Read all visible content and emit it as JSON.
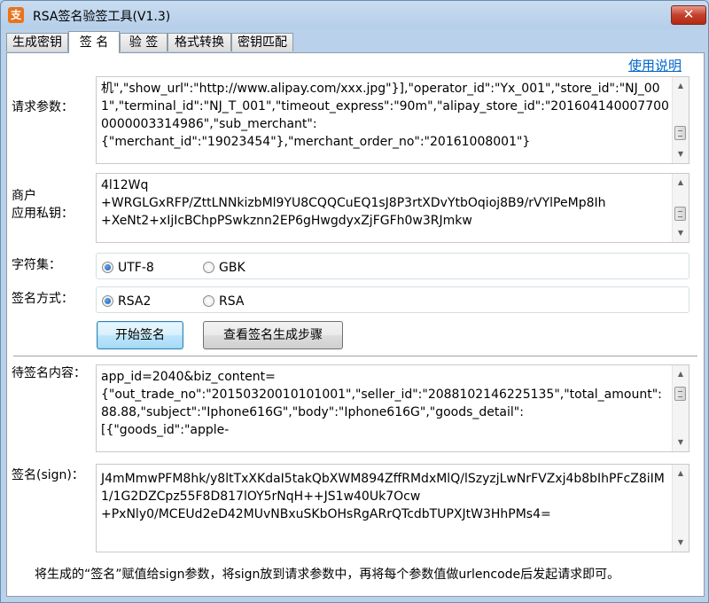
{
  "window": {
    "title": "RSA签名验签工具(V1.3)",
    "icon_name": "app-logo-icon",
    "close_glyph": "✕"
  },
  "tabs": [
    {
      "label": "生成密钥",
      "active": false
    },
    {
      "label": "签 名",
      "active": true
    },
    {
      "label": "验 签",
      "active": false
    },
    {
      "label": "格式转换",
      "active": false
    },
    {
      "label": "密钥匹配",
      "active": false
    }
  ],
  "help_link": "使用说明",
  "request_params": {
    "label": "请求参数：",
    "value": "机\",\"show_url\":\"http://www.alipay.com/xxx.jpg\"}],\"operator_id\":\"Yx_001\",\"store_id\":\"NJ_001\",\"terminal_id\":\"NJ_T_001\",\"timeout_express\":\"90m\",\"alipay_store_id\":\"2016041400077000000003314986\",\"sub_merchant\":\n{\"merchant_id\":\"19023454\"},\"merchant_order_no\":\"20161008001\"}"
  },
  "private_key": {
    "label_line1": "商户",
    "label_line2": "应用私钥：",
    "value": "4l12Wq\n+WRGLGxRFP/ZttLNNkizbMl9YU8CQQCuEQ1sJ8P3rtXDvYtbOqioj8B9/rVYlPeMp8Ih\n+XeNt2+xIjIcBChpPSwkznn2EP6gHwgdyxZjFGFh0w3RJmkw"
  },
  "charset": {
    "label": "字符集：",
    "options": [
      "UTF-8",
      "GBK"
    ],
    "selected": "UTF-8"
  },
  "sign_method": {
    "label": "签名方式：",
    "options": [
      "RSA2",
      "RSA"
    ],
    "selected": "RSA2"
  },
  "buttons": {
    "start_sign": "开始签名",
    "view_steps": "查看签名生成步骤"
  },
  "pending_content": {
    "label": "待签名内容：",
    "value": "app_id=2040&biz_content=\n{\"out_trade_no\":\"20150320010101001\",\"seller_id\":\"2088102146225135\",\"total_amount\":88.88,\"subject\":\"Iphone616G\",\"body\":\"Iphone616G\",\"goods_detail\":\n[{\"goods_id\":\"apple-"
  },
  "signature": {
    "label": "签名(sign)：",
    "value": "J4mMmwPFM8hk/y8ltTxXKdaI5takQbXWM894ZffRMdxMlQ/lSzyzjLwNrFVZxj4b8bIhPFcZ8iIM1/1G2DZCpz55F8D817lOY5rNqH++JS1w40Uk7Ocw\n+PxNly0/MCEUd2eD42MUvNBxuSKbOHsRgARrQTcdbTUPXJtW3HhPMs4="
  },
  "footer_note": "将生成的“签名”赋值给sign参数，将sign放到请求参数中，再将每个参数值做urlencode后发起请求即可。"
}
